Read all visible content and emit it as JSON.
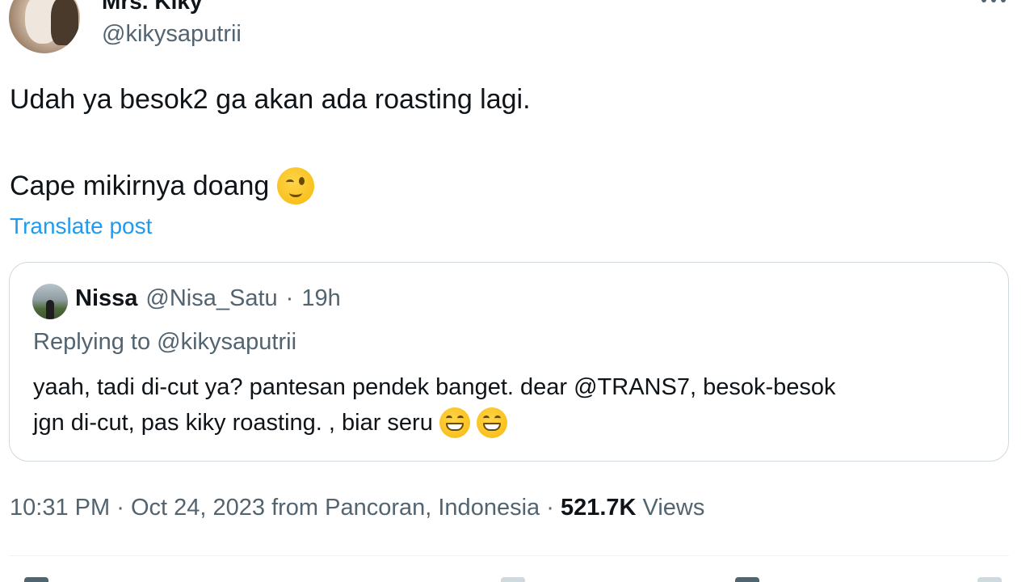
{
  "author": {
    "display_name": "Mrs. Kiky",
    "handle": "@kikysaputrii",
    "more_icon": "more-horizontal-icon"
  },
  "tweet": {
    "line1": "Udah ya besok2 ga akan ada roasting lagi.",
    "line2": "Cape mikirnya doang",
    "line2_emoji": "winking-face-emoji",
    "translate_label": "Translate post"
  },
  "quote": {
    "name": "Nissa",
    "handle": "@Nisa_Satu",
    "separator": "·",
    "time": "19h",
    "replying_to": "Replying to @kikysaputrii",
    "body_line1": "yaah, tadi di-cut ya? pantesan pendek banget. dear @TRANS7, besok-besok",
    "body_line2": "jgn di-cut, pas kiky roasting. , biar seru",
    "body_emojis": [
      "grinning-face-emoji",
      "grinning-face-emoji"
    ]
  },
  "footer": {
    "time": "10:31 PM",
    "date": "Oct 24, 2023",
    "location": "from Pancoran, Indonesia",
    "views_count": "521.7K",
    "views_label": "Views",
    "separator": "·"
  },
  "colors": {
    "text_primary": "#0f1419",
    "text_secondary": "#536471",
    "link": "#1d9bf0",
    "border": "#cfd9de"
  }
}
